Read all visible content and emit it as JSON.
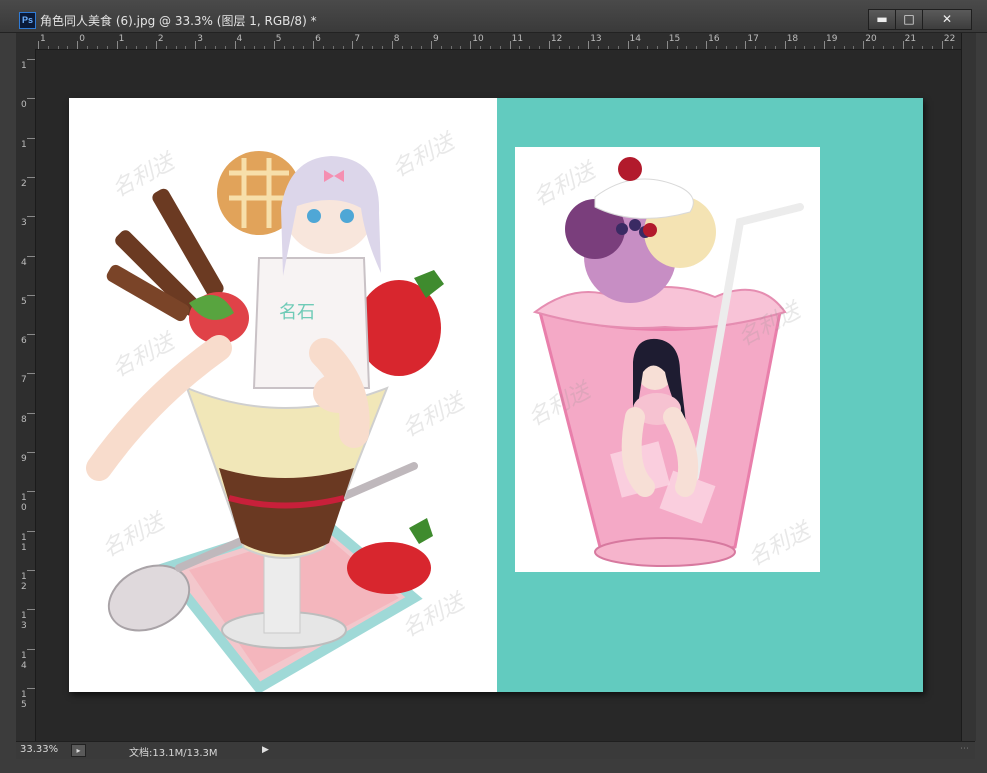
{
  "window": {
    "app_icon": "Ps",
    "title": "角色同人美食 (6).jpg @ 33.3% (图层 1, RGB/8) *",
    "buttons": {
      "minimize": "minimize-icon",
      "maximize": "maximize-icon",
      "close": "close-icon"
    }
  },
  "ruler": {
    "h_labels": [
      "1",
      "0",
      "1",
      "2",
      "3",
      "4",
      "5",
      "6",
      "7",
      "8",
      "9",
      "10",
      "11",
      "12",
      "13",
      "14",
      "15",
      "16",
      "17",
      "18",
      "19",
      "20",
      "21",
      "22"
    ],
    "v_labels": [
      "1",
      "0",
      "1",
      "2",
      "3",
      "4",
      "5",
      "6",
      "7",
      "8",
      "9",
      "10",
      "11",
      "12",
      "13",
      "14",
      "15"
    ]
  },
  "canvas": {
    "left_background": "#ffffff",
    "right_background": "#62cbbf",
    "watermark_text": "名利送",
    "left_image": "anime girl sitting in strawberry parfait",
    "right_image": "anime girl in pink ice cream glass"
  },
  "status": {
    "zoom": "33.33%",
    "doc_size": "文档:13.1M/13.3M"
  },
  "colors": {
    "accent": "#2f7bd6",
    "teal": "#62cbbf",
    "pink": "#f3a6c4",
    "strawberry": "#d8262e"
  }
}
